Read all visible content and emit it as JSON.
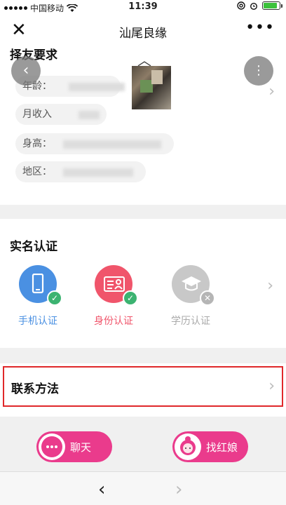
{
  "status_bar": {
    "carrier": "中国移动",
    "time": "11:39",
    "battery_level": 0.85
  },
  "nav": {
    "close_icon": "close-icon",
    "title": "汕尾良缘",
    "more_icon": "more-horizontal-icon"
  },
  "requirements": {
    "title": "择友要求",
    "fields": [
      {
        "label": "年龄："
      },
      {
        "label": "月收入"
      },
      {
        "label": "身高："
      },
      {
        "label": "地区："
      }
    ]
  },
  "verification": {
    "title": "实名认证",
    "items": [
      {
        "label": "手机认证",
        "icon": "phone-icon",
        "verified": true,
        "color": "#4a90e2"
      },
      {
        "label": "身份认证",
        "icon": "id-card-icon",
        "verified": true,
        "color": "#f0556b"
      },
      {
        "label": "学历认证",
        "icon": "graduation-cap-icon",
        "verified": false,
        "color": "#c8c8c8"
      }
    ]
  },
  "contact": {
    "title": "联系方法"
  },
  "actions": {
    "chat_label": "聊天",
    "matchmaker_label": "找红娘"
  },
  "colors": {
    "accent_pink": "#ea3b8c",
    "verified_green": "#3cb371",
    "highlight_red": "#e0282a"
  }
}
